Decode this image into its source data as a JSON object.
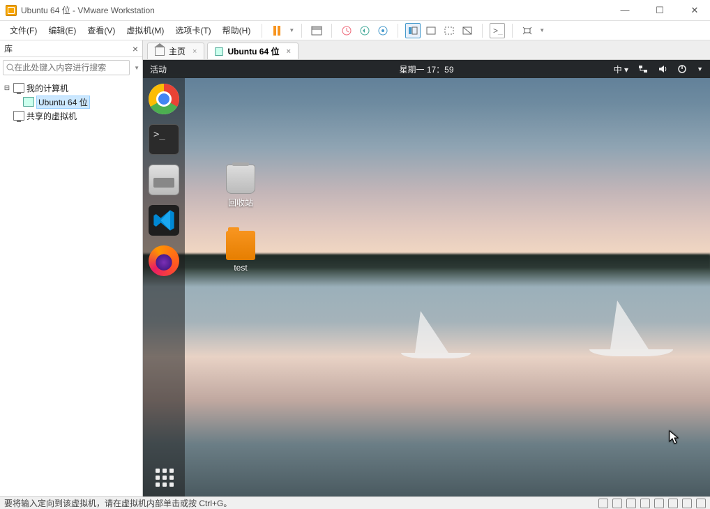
{
  "window": {
    "title": "Ubuntu 64 位 - VMware Workstation"
  },
  "menu": {
    "file": "文件(F)",
    "edit": "编辑(E)",
    "view": "查看(V)",
    "vm": "虚拟机(M)",
    "tabs": "选项卡(T)",
    "help": "帮助(H)"
  },
  "library": {
    "title": "库",
    "search_placeholder": "在此处键入内容进行搜索",
    "tree": {
      "my_computer": "我的计算机",
      "ubuntu": "Ubuntu 64 位",
      "shared": "共享的虚拟机"
    }
  },
  "tabs": {
    "home": "主页",
    "ubuntu": "Ubuntu 64 位"
  },
  "gnome": {
    "activities": "活动",
    "clock": "星期一 17：59",
    "ime": "中"
  },
  "desktop": {
    "trash": "回收站",
    "folder": "test"
  },
  "statusbar": {
    "hint": "要将输入定向到该虚拟机，请在虚拟机内部单击或按 Ctrl+G。"
  }
}
